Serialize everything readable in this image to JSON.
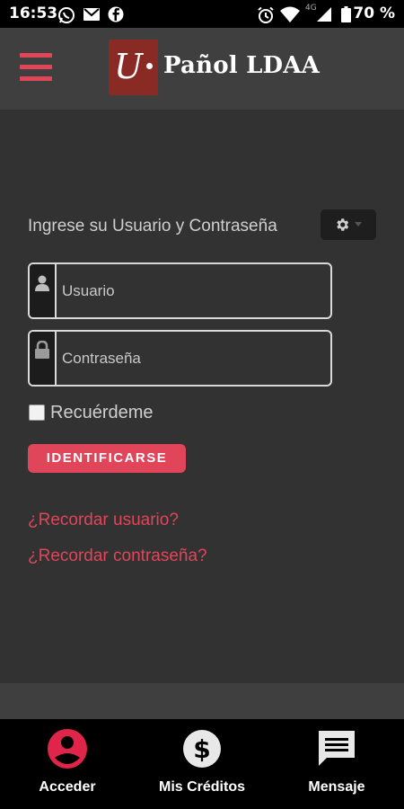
{
  "status_bar": {
    "time": "16:53",
    "network": "4G",
    "battery": "70 %",
    "left_icons": [
      "whatsapp-icon",
      "gmail-icon",
      "facebook-icon"
    ],
    "right_icons": [
      "alarm-icon",
      "wifi-icon",
      "signal-icon",
      "battery-icon"
    ]
  },
  "header": {
    "logo_letter": "U",
    "title": "Pañol LDAA",
    "accent_color": "#e0455a",
    "logo_color": "#8a2a24"
  },
  "login": {
    "prompt": "Ingrese su Usuario y Contraseña",
    "username_placeholder": "Usuario",
    "password_placeholder": "Contraseña",
    "remember_label": "Recuérdeme",
    "submit_label": "IDENTIFICARSE",
    "forgot_user": "¿Recordar usuario?",
    "forgot_password": "¿Recordar contraseña?"
  },
  "bottom_nav": {
    "items": [
      {
        "label": "Acceder",
        "icon": "account-circle-icon",
        "active": true
      },
      {
        "label": "Mis Créditos",
        "icon": "dollar-circle-icon",
        "active": false
      },
      {
        "label": "Mensaje",
        "icon": "message-icon",
        "active": false
      }
    ]
  }
}
